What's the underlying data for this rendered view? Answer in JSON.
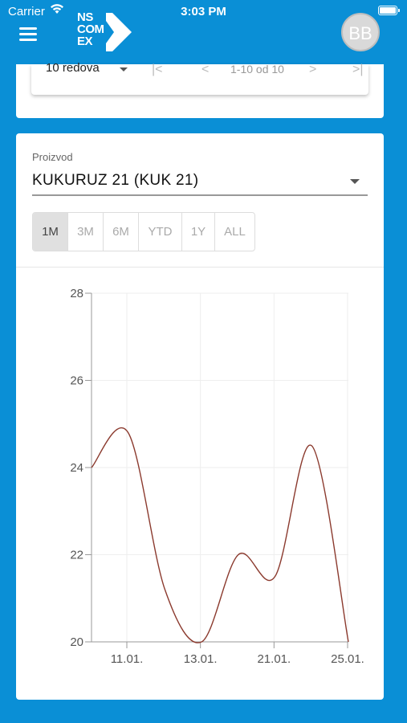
{
  "status_bar": {
    "carrier": "Carrier",
    "time": "3:03 PM"
  },
  "app_bar": {
    "logo_lines": [
      "NS",
      "COM",
      "EX"
    ],
    "avatar_initials": "BB"
  },
  "paginator": {
    "rows_per_page": "10 redova",
    "range": "1-10 od 10"
  },
  "product_field": {
    "label": "Proizvod",
    "value": "KUKURUZ 21 (KUK 21)"
  },
  "range_buttons": [
    {
      "label": "1M",
      "active": true
    },
    {
      "label": "3M",
      "active": false
    },
    {
      "label": "6M",
      "active": false
    },
    {
      "label": "YTD",
      "active": false
    },
    {
      "label": "1Y",
      "active": false
    },
    {
      "label": "ALL",
      "active": false
    }
  ],
  "colors": {
    "accent": "#0a8fd6",
    "line": "#8b3a2e"
  },
  "chart_data": {
    "type": "line",
    "x_ticks": [
      "11.01.",
      "13.01.",
      "21.01.",
      "25.01."
    ],
    "y_ticks": [
      20,
      22,
      24,
      26,
      28
    ],
    "ylim": [
      20,
      28
    ],
    "grid": true,
    "series": [
      {
        "values": [
          24.0,
          24.8,
          21.2,
          20.0,
          22.0,
          21.5,
          24.5,
          20.0
        ]
      }
    ]
  }
}
